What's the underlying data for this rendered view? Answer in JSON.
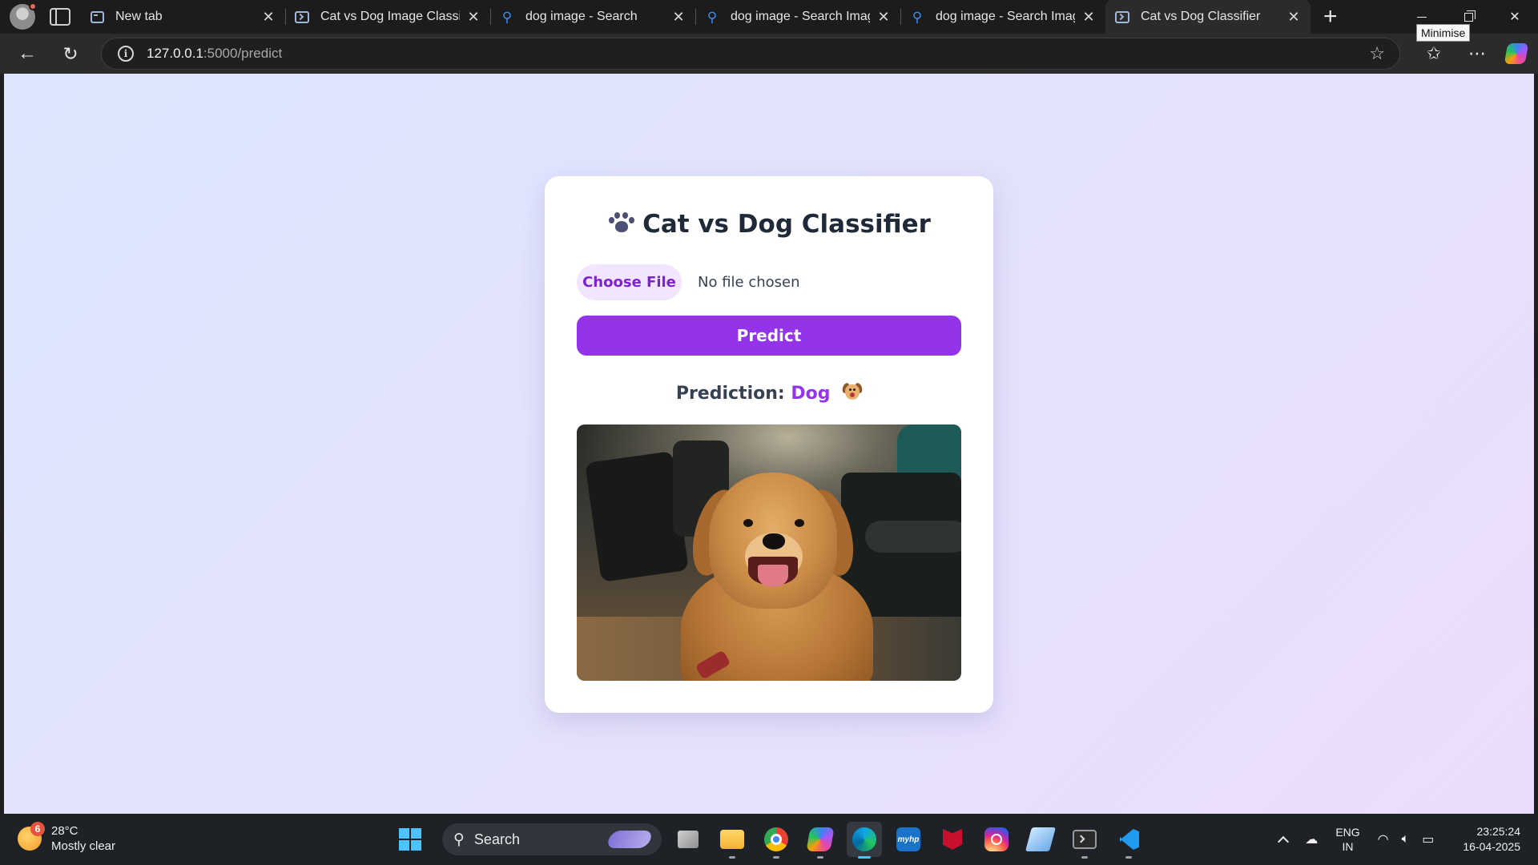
{
  "browser": {
    "tabs": [
      {
        "title": "New tab",
        "icon": "page-icon",
        "active": false
      },
      {
        "title": "Cat vs Dog Image Classifier",
        "icon": "terminal-page-icon",
        "active": false
      },
      {
        "title": "dog image - Search",
        "icon": "search-icon",
        "active": false
      },
      {
        "title": "dog image - Search Images",
        "icon": "search-icon",
        "active": false
      },
      {
        "title": "dog image - Search Images",
        "icon": "search-icon",
        "active": false
      },
      {
        "title": "Cat vs Dog Classifier",
        "icon": "terminal-page-icon",
        "active": true
      }
    ],
    "tooltip": "Minimise",
    "address": {
      "host": "127.0.0.1",
      "path": ":5000/predict"
    }
  },
  "page": {
    "title": "Cat vs Dog Classifier",
    "choose_file_label": "Choose File",
    "file_status": "No file chosen",
    "predict_label": "Predict",
    "prediction_label": "Prediction:",
    "prediction_value": "Dog",
    "accent_color": "#9333ea"
  },
  "taskbar": {
    "weather": {
      "temperature": "28°C",
      "condition": "Mostly clear",
      "badge": "6"
    },
    "search_label": "Search",
    "language": {
      "line1": "ENG",
      "line2": "IN"
    },
    "clock": {
      "time": "23:25:24",
      "date": "16-04-2025"
    },
    "apps": [
      "task-view",
      "file-explorer",
      "chrome",
      "copilot",
      "edge",
      "myhp",
      "mcafee",
      "instagram",
      "pen-app",
      "terminal",
      "vscode"
    ]
  }
}
